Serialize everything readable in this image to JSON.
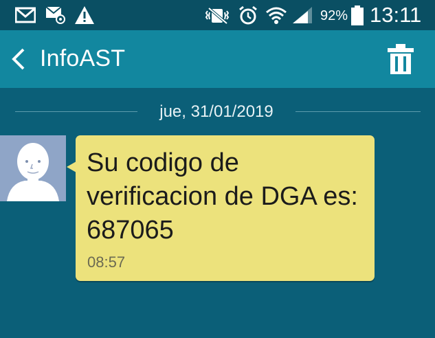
{
  "status_bar": {
    "icons_left": [
      "gmail-icon",
      "email-at-icon",
      "warning-icon"
    ],
    "icons_right": [
      "mute-vibrate-icon",
      "alarm-icon",
      "wifi-icon",
      "signal-icon",
      "battery-icon"
    ],
    "battery_percent": "92%",
    "battery_level": 0.92,
    "time": "13:11"
  },
  "app_bar": {
    "title": "InfoAST",
    "back_icon": "chevron-left-icon",
    "delete_icon": "trash-icon"
  },
  "conversation": {
    "date_label": "jue, 31/01/2019",
    "messages": [
      {
        "text": "Su codigo de verificacion de DGA es: 687065",
        "time": "08:57",
        "avatar_icon": "default-contact-avatar"
      }
    ]
  },
  "colors": {
    "status_bar_bg": "#0a4f63",
    "app_bar_bg": "#12879f",
    "background": "#0b5f78",
    "bubble_bg": "#ece27c",
    "avatar_bg": "#8fa5c7"
  }
}
